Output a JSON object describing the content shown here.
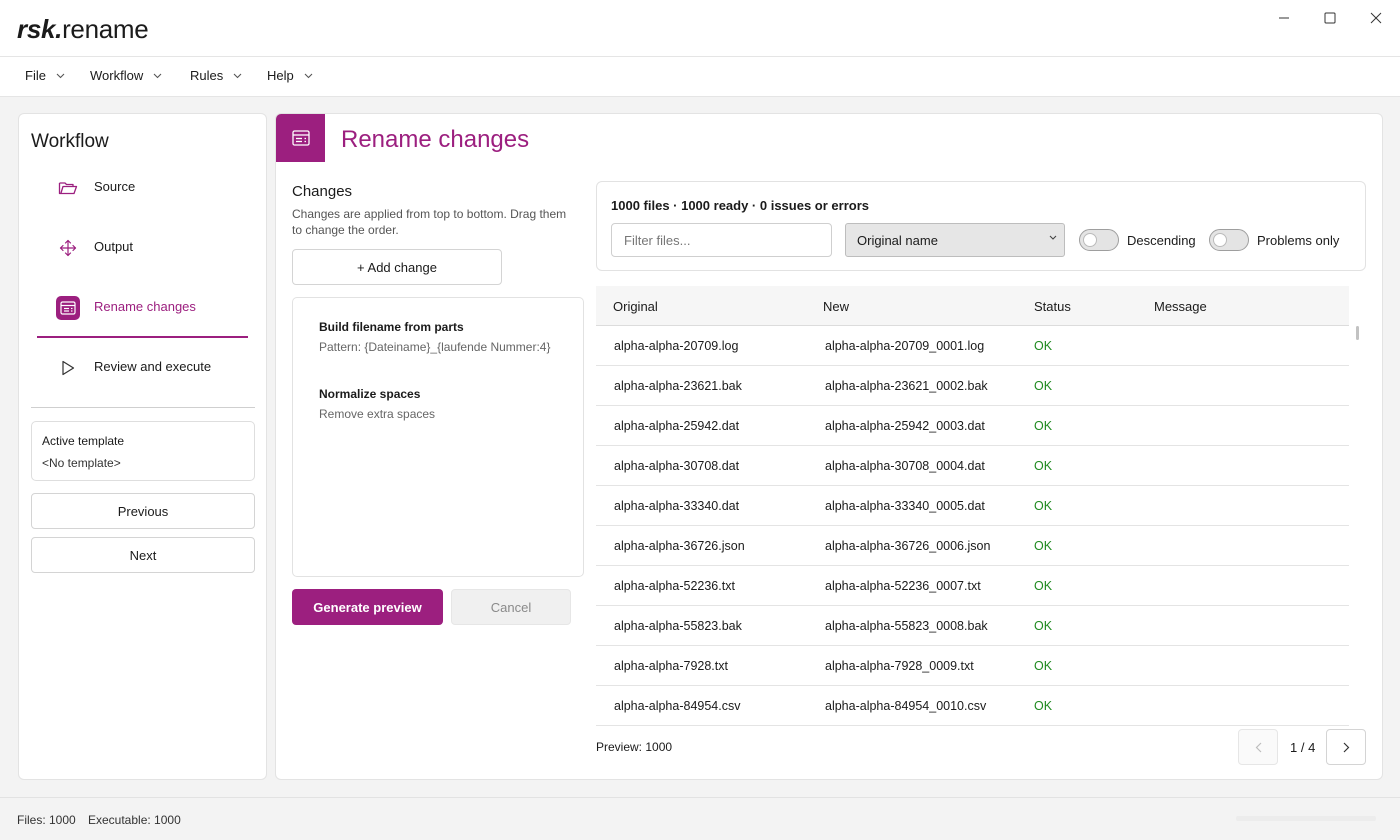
{
  "app": {
    "logo_bold": "rsk.",
    "logo_rest": "rename"
  },
  "menu": {
    "items": [
      {
        "label": "File"
      },
      {
        "label": "Workflow"
      },
      {
        "label": "Rules"
      },
      {
        "label": "Help"
      }
    ]
  },
  "sidebar": {
    "title": "Workflow",
    "items": [
      {
        "label": "Source",
        "icon": "folder-icon"
      },
      {
        "label": "Output",
        "icon": "move-icon"
      },
      {
        "label": "Rename changes",
        "icon": "changes-icon",
        "active": true
      },
      {
        "label": "Review and execute",
        "icon": "play-icon"
      }
    ],
    "template_label": "Active template",
    "template_value": "<No template>",
    "previous_label": "Previous",
    "next_label": "Next"
  },
  "main": {
    "title": "Rename changes",
    "changes": {
      "title": "Changes",
      "description": "Changes are applied from top to bottom. Drag them to change the order.",
      "add_label": "+ Add change",
      "items": [
        {
          "title": "Build filename from parts",
          "detail": "Pattern: {Dateiname}_{laufende Nummer:4}"
        },
        {
          "title": "Normalize spaces",
          "detail": "Remove extra spaces"
        }
      ],
      "generate_label": "Generate preview",
      "cancel_label": "Cancel"
    },
    "filter": {
      "summary": "1000 files · 1000 ready · 0 issues or errors",
      "search_placeholder": "Filter files...",
      "sort_value": "Original name",
      "descending_label": "Descending",
      "problems_label": "Problems only"
    },
    "table": {
      "headers": [
        "Original",
        "New",
        "Status",
        "Message"
      ],
      "rows": [
        {
          "original": "alpha-alpha-20709.log",
          "new": "alpha-alpha-20709_0001.log",
          "status": "OK",
          "message": ""
        },
        {
          "original": "alpha-alpha-23621.bak",
          "new": "alpha-alpha-23621_0002.bak",
          "status": "OK",
          "message": ""
        },
        {
          "original": "alpha-alpha-25942.dat",
          "new": "alpha-alpha-25942_0003.dat",
          "status": "OK",
          "message": ""
        },
        {
          "original": "alpha-alpha-30708.dat",
          "new": "alpha-alpha-30708_0004.dat",
          "status": "OK",
          "message": ""
        },
        {
          "original": "alpha-alpha-33340.dat",
          "new": "alpha-alpha-33340_0005.dat",
          "status": "OK",
          "message": ""
        },
        {
          "original": "alpha-alpha-36726.json",
          "new": "alpha-alpha-36726_0006.json",
          "status": "OK",
          "message": ""
        },
        {
          "original": "alpha-alpha-52236.txt",
          "new": "alpha-alpha-52236_0007.txt",
          "status": "OK",
          "message": ""
        },
        {
          "original": "alpha-alpha-55823.bak",
          "new": "alpha-alpha-55823_0008.bak",
          "status": "OK",
          "message": ""
        },
        {
          "original": "alpha-alpha-7928.txt",
          "new": "alpha-alpha-7928_0009.txt",
          "status": "OK",
          "message": ""
        },
        {
          "original": "alpha-alpha-84954.csv",
          "new": "alpha-alpha-84954_0010.csv",
          "status": "OK",
          "message": ""
        }
      ]
    },
    "preview_count": "Preview: 1000",
    "page_label": "1 / 4"
  },
  "status": {
    "files": "Files: 1000",
    "executable": "Executable: 1000"
  },
  "colors": {
    "accent": "#9c1f7f",
    "ok": "#1f8a1f"
  }
}
